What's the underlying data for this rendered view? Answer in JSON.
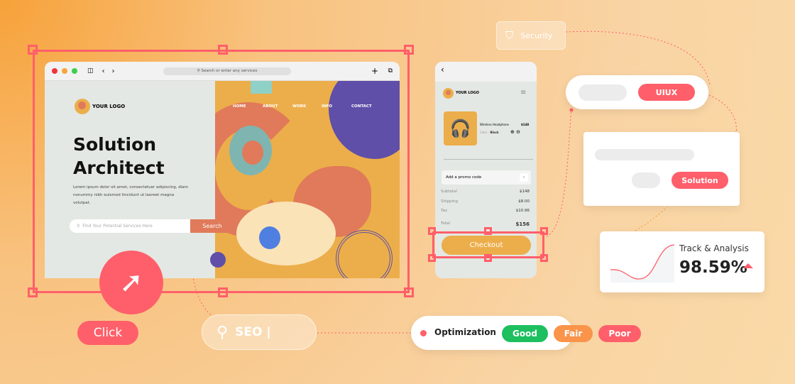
{
  "browser": {
    "url_placeholder": "Search or enter any services",
    "logo": "YOUR LOGO",
    "nav": [
      "HOME",
      "ABOUT",
      "WORK",
      "INFO",
      "CONTACT"
    ],
    "title_line1": "Solution",
    "title_line2": "Architect",
    "description": "Lorem ipsum dolor sit amet, consectetuer adipiscing, diam nonummy nibh euismod tincidunt ut laoreet magna volutpat.",
    "search_placeholder": "Find Your Potential Services Here",
    "search_button": "Search"
  },
  "phone": {
    "logo": "YOUR LOGO",
    "product": "Wireless Headphone",
    "price": "$148",
    "color_label": "Color -",
    "color_value": "Black",
    "promo": "Add a promo code",
    "summary": [
      {
        "label": "Subtotal",
        "value": "$148"
      },
      {
        "label": "Shipping",
        "value": "$8.00"
      },
      {
        "label": "Tax",
        "value": "$10.96"
      }
    ],
    "total_label": "Total",
    "total_value": "$156",
    "checkout": "Checkout"
  },
  "security": {
    "label": "Security"
  },
  "uiux": {
    "label": "UIUX"
  },
  "solution": {
    "label": "Solution"
  },
  "track": {
    "title": "Track & Analysis",
    "value": "98.59%"
  },
  "click": {
    "label": "Click"
  },
  "seo": {
    "text": "SEO |"
  },
  "optimization": {
    "label": "Optimization",
    "ratings": [
      {
        "label": "Good",
        "color": "#1dbf5f"
      },
      {
        "label": "Fair",
        "color": "#f9944a"
      },
      {
        "label": "Poor",
        "color": "#ff5f6a"
      }
    ]
  },
  "colors": {
    "accent": "#ff5f6a",
    "orange": "#ecae4a"
  }
}
